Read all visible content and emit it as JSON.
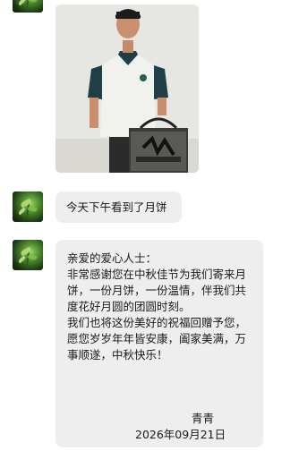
{
  "messages": [
    {
      "type": "image",
      "description": "photo"
    },
    {
      "type": "text",
      "text": "今天下午看到了月饼"
    },
    {
      "type": "text",
      "lines": [
        "亲爱的爱心人士：",
        "非常感谢您在中秋佳节为我们寄来月",
        "饼，一份月饼，一份温情，伴我们共",
        "度花好月圆的团圆时刻。",
        "我们也将这份美好的祝福回赠予您，",
        "愿您岁岁年年皆安康，阖家美满，万",
        "事顺遂，中秋快乐！"
      ],
      "signature": "青青",
      "date": "2026年09月21日"
    }
  ],
  "colors": {
    "bubble": "#eeeeee",
    "background": "#ffffff"
  }
}
